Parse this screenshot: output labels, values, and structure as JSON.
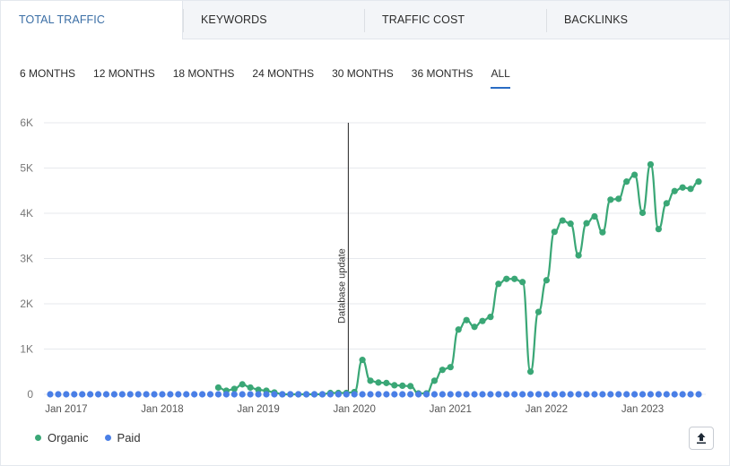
{
  "tabs": [
    {
      "label": "TOTAL TRAFFIC",
      "active": true
    },
    {
      "label": "KEYWORDS",
      "active": false
    },
    {
      "label": "TRAFFIC COST",
      "active": false
    },
    {
      "label": "BACKLINKS",
      "active": false
    }
  ],
  "ranges": [
    "6 MONTHS",
    "12 MONTHS",
    "18 MONTHS",
    "24 MONTHS",
    "30 MONTHS",
    "36 MONTHS",
    "ALL"
  ],
  "active_range": "ALL",
  "legend": {
    "organic_label": "Organic",
    "paid_label": "Paid"
  },
  "export_icon": "upload-icon",
  "colors": {
    "organic": "#3aa776",
    "paid": "#4a7fe6",
    "active_tab_text": "#3a6ea5",
    "range_underline": "#2a6cc4"
  },
  "chart_data": {
    "type": "line",
    "x_start": "2016-11",
    "x_interval": "monthly",
    "y_ticks": [
      "0",
      "1K",
      "2K",
      "3K",
      "4K",
      "5K",
      "6K"
    ],
    "ylim": [
      0,
      6000
    ],
    "x_tick_labels": [
      "Jan 2017",
      "Jan 2018",
      "Jan 2019",
      "Jan 2020",
      "Jan 2021",
      "Jan 2022",
      "Jan 2023"
    ],
    "grid": true,
    "legend_position": "bottom-left",
    "annotations": [
      {
        "x": "2020-01",
        "label": "Database update"
      }
    ],
    "series": [
      {
        "name": "Organic",
        "values": [
          0,
          0,
          0,
          0,
          0,
          0,
          0,
          0,
          0,
          0,
          0,
          0,
          0,
          0,
          0,
          0,
          0,
          0,
          0,
          0,
          0,
          150,
          80,
          120,
          220,
          150,
          100,
          80,
          40,
          0,
          0,
          0,
          0,
          0,
          0,
          30,
          30,
          30,
          50,
          760,
          300,
          260,
          250,
          200,
          190,
          180,
          20,
          20,
          300,
          540,
          600,
          1430,
          1640,
          1490,
          1620,
          1710,
          2440,
          2550,
          2550,
          2480,
          500,
          1820,
          2520,
          3590,
          3840,
          3770,
          3070,
          3780,
          3930,
          3580,
          4300,
          4320,
          4700,
          4850,
          4010,
          5080,
          3650,
          4220,
          4490,
          4570,
          4540,
          4700
        ],
        "points_from_index": 21
      },
      {
        "name": "Paid",
        "values": [
          0,
          0,
          0,
          0,
          0,
          0,
          0,
          0,
          0,
          0,
          0,
          0,
          0,
          0,
          0,
          0,
          0,
          0,
          0,
          0,
          0,
          0,
          0,
          0,
          0,
          0,
          0,
          0,
          0,
          0,
          0,
          0,
          0,
          0,
          0,
          0,
          0,
          0,
          0,
          0,
          0,
          0,
          0,
          0,
          0,
          0,
          0,
          0,
          0,
          0,
          0,
          0,
          0,
          0,
          0,
          0,
          0,
          0,
          0,
          0,
          0,
          0,
          0,
          0,
          0,
          0,
          0,
          0,
          0,
          0,
          0,
          0,
          0,
          0,
          0,
          0,
          0,
          0,
          0,
          0,
          0,
          0
        ]
      }
    ]
  }
}
